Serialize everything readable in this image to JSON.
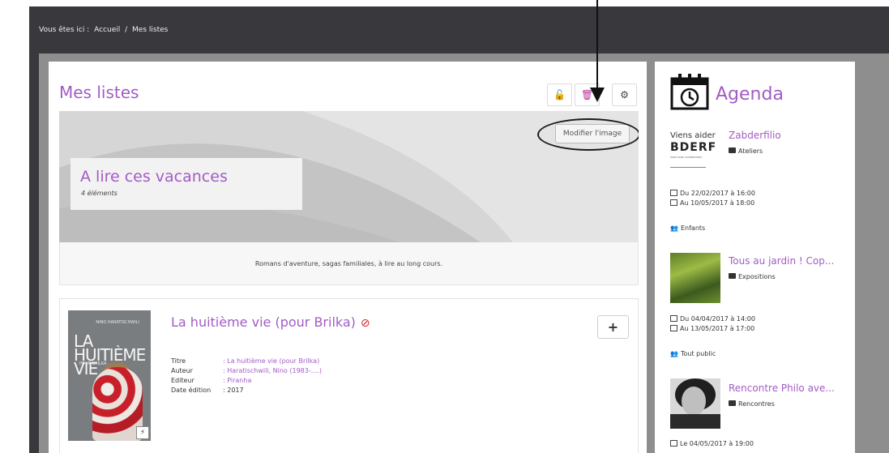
{
  "breadcrumb": {
    "prefix": "Vous êtes ici :",
    "home": "Accueil",
    "separator": "/",
    "current": "Mes listes"
  },
  "list": {
    "title": "Mes listes",
    "banner_button": "Modifier l'image",
    "name": "A lire ces vacances",
    "count": "4 éléments",
    "description": "Romans d'aventure, sagas familiales, à lire au long cours."
  },
  "book": {
    "title": "La huitième vie (pour Brilka)",
    "add_label": "+",
    "cover_author": "NINO HARATISCHWILI",
    "cover_title": "LA HUITIÈME VIE",
    "cover_sub": "POUR BRILKA",
    "meta": [
      {
        "label": "Titre",
        "value": ": La huitième vie (pour Brilka)",
        "link": true
      },
      {
        "label": "Auteur",
        "value": ": Haratischwili, Nino (1983-....)",
        "link": true
      },
      {
        "label": "Editeur",
        "value": ": Piranha",
        "link": true
      },
      {
        "label": "Date édition",
        "value": ": 2017",
        "link": false
      }
    ]
  },
  "agenda": {
    "title": "Agenda",
    "events": [
      {
        "title": "Zabderfilio",
        "category": "Ateliers",
        "thumb_line1": "Viens aider",
        "thumb_line2": "BDERF",
        "thumb_line3": "MAIN SANS SUSPENSIONS",
        "date_from": "Du 22/02/2017 à 16:00",
        "date_to": "Au 10/05/2017 à 18:00",
        "audience": "Enfants"
      },
      {
        "title": "Tous au jardin ! Cop...",
        "category": "Expositions",
        "date_from": "Du 04/04/2017 à 14:00",
        "date_to": "Au 13/05/2017 à 17:00",
        "audience": "Tout public"
      },
      {
        "title": "Rencontre Philo ave...",
        "category": "Rencontres",
        "date_single": "Le 04/05/2017 à 19:00"
      }
    ]
  },
  "colors": {
    "accent": "#a25cc4",
    "dark_bg": "#38383d",
    "gray_frame": "#8e8e8e",
    "danger": "#d9232e",
    "unlock": "#e09418"
  },
  "icons": [
    "unlock-icon",
    "trash-icon",
    "gear-icon",
    "no-entry-icon",
    "flash-icon",
    "calendar-icon",
    "folder-icon",
    "users-icon"
  ]
}
